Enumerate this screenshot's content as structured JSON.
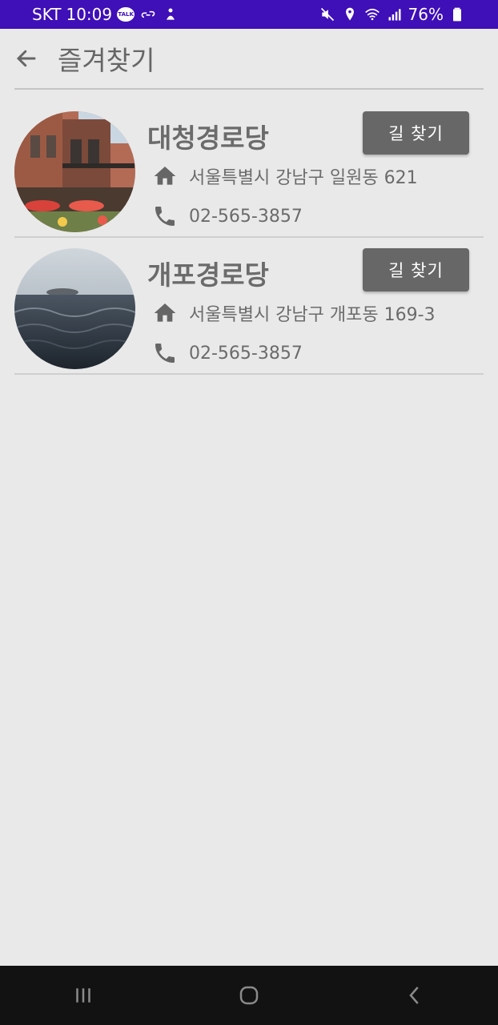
{
  "status_bar": {
    "carrier": "SKT",
    "time": "10:09",
    "talk_badge": "TALK",
    "battery": "76%",
    "background_color": "#3f0fb7"
  },
  "header": {
    "back_icon": "arrow-back-icon",
    "title": "즐겨찾기"
  },
  "favorites": [
    {
      "name": "대청경로당",
      "route_button": "길 찾기",
      "address": "서울특별시 강남구 일원동 621",
      "phone": "02-565-3857",
      "thumbnail": "building-photo"
    },
    {
      "name": "개포경로당",
      "route_button": "길 찾기",
      "address": "서울특별시 강남구 개포동 169-3",
      "phone": "02-565-3857",
      "thumbnail": "ocean-photo"
    }
  ],
  "icons": {
    "address": "home-icon",
    "phone": "phone-icon"
  },
  "navigation_bar": {
    "buttons": [
      "recent-apps-icon",
      "home-button-icon",
      "back-nav-icon"
    ]
  },
  "colors": {
    "background": "#e9e9e9",
    "button": "#676767",
    "text": "#6b6b6b"
  }
}
